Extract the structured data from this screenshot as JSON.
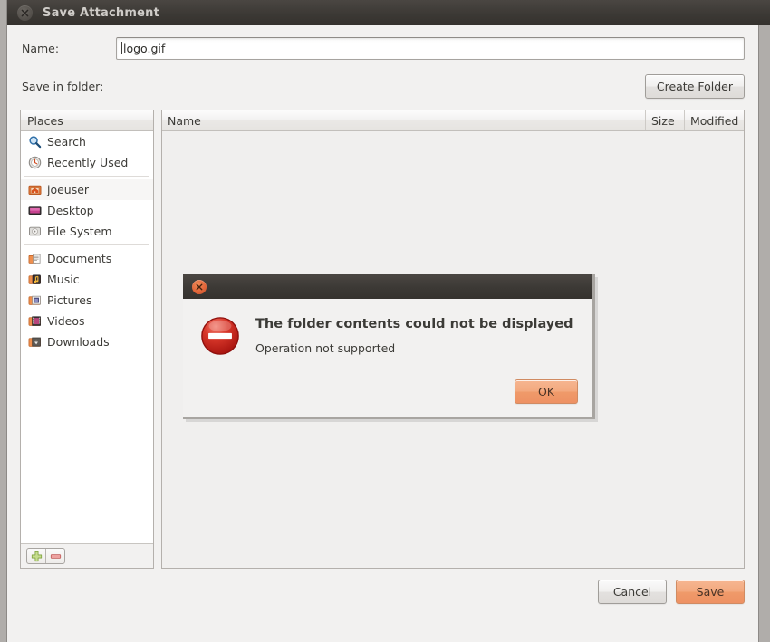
{
  "window": {
    "title": "Save Attachment",
    "close_icon": "close-icon"
  },
  "form": {
    "name_label": "Name:",
    "name_value": "logo.gif",
    "name_placeholder": "",
    "folder_label": "Save in folder:",
    "create_folder_label": "Create Folder"
  },
  "places": {
    "header": "Places",
    "items": [
      {
        "label": "Search",
        "icon": "search-icon"
      },
      {
        "label": "Recently Used",
        "icon": "recently-used-icon"
      },
      {
        "label": "joeuser",
        "icon": "home-folder-icon"
      },
      {
        "label": "Desktop",
        "icon": "desktop-icon"
      },
      {
        "label": "File System",
        "icon": "hard-drive-icon"
      },
      {
        "label": "Documents",
        "icon": "documents-folder-icon"
      },
      {
        "label": "Music",
        "icon": "music-folder-icon"
      },
      {
        "label": "Pictures",
        "icon": "pictures-folder-icon"
      },
      {
        "label": "Videos",
        "icon": "videos-folder-icon"
      },
      {
        "label": "Downloads",
        "icon": "downloads-folder-icon"
      }
    ],
    "add_icon": "plus-icon",
    "remove_icon": "minus-icon"
  },
  "filelist": {
    "columns": {
      "name": "Name",
      "size": "Size",
      "modified": "Modified"
    },
    "rows": []
  },
  "actions": {
    "cancel_label": "Cancel",
    "save_label": "Save"
  },
  "error_dialog": {
    "close_icon": "close-icon",
    "icon": "error-stop-icon",
    "primary_text": "The folder contents could not be displayed",
    "secondary_text": "Operation not supported",
    "ok_label": "OK"
  },
  "colors": {
    "accent": "#f09a68",
    "titlebar": "#3b3834",
    "error_red": "#cf2b20",
    "window_bg": "#f2f1f0",
    "dialog_close": "#e2663a"
  }
}
